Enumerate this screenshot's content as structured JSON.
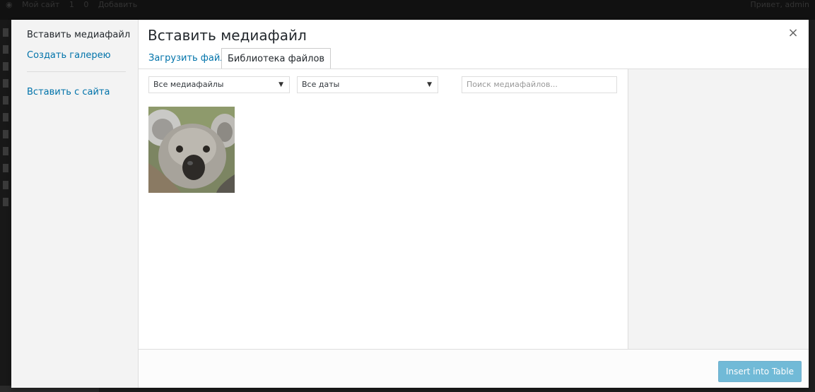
{
  "adminbar": {
    "site": "Мой сайт",
    "updates": "1",
    "comments": "0",
    "add_new": "Добавить",
    "greeting": "Привет, admin"
  },
  "modal": {
    "menu": {
      "insert_media": "Вставить медиафайл",
      "create_gallery": "Создать галерею",
      "insert_from_url": "Вставить с сайта"
    },
    "title": "Вставить медиафайл",
    "close_label": "×",
    "tabs": {
      "upload": "Загрузить файлы",
      "library": "Библиотека файлов"
    },
    "filters": {
      "type_selected": "Все медиафайлы",
      "date_selected": "Все даты",
      "search_placeholder": "Поиск медиафайлов..."
    },
    "attachments": [
      {
        "icon": "koala-image-thumbnail"
      }
    ],
    "footer": {
      "insert_button": "Insert into Table"
    }
  },
  "colors": {
    "accent": "#0085ba",
    "link": "#0073aa",
    "sidebar_bg": "#f3f3f3"
  }
}
